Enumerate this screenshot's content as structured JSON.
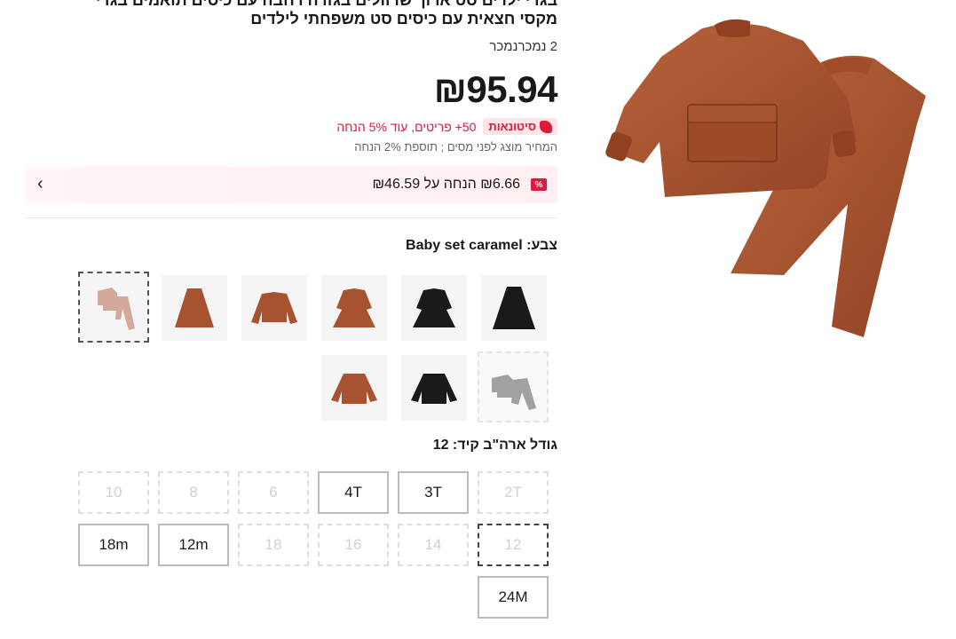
{
  "product": {
    "title_line1": "בגדי ילדים סט ארוך שרוולים בגזרה רחבה עם כיסים תואמים בגדי",
    "title_line2": "מקסי חצאית עם כיסים סט משפחתי לילדים",
    "sold": "2 נמכרנמכר",
    "price": "₪95.94",
    "bulk_tag": "סיטונאות",
    "bulk_text": "50+ פריטים, עוד 5% הנחה",
    "tax_note": "המחיר מוצג לפני מסים ; תוספת 2% הנחה",
    "coupon_badge": "%",
    "coupon_text": "₪6.66 הנחה על ₪46.59",
    "coupon_arrow": "›"
  },
  "color": {
    "label": "צבע: Baby set caramel",
    "options": [
      {
        "name": "Baby set caramel",
        "state": "selected",
        "icon": "pants-set-pink"
      },
      {
        "name": "caramel maxi skirt",
        "state": "normal",
        "icon": "skirt-brown"
      },
      {
        "name": "caramel jacket",
        "state": "normal",
        "icon": "jacket-brown"
      },
      {
        "name": "caramel dress",
        "state": "normal",
        "icon": "dress-brown"
      },
      {
        "name": "black dress",
        "state": "normal",
        "icon": "dress-black"
      },
      {
        "name": "black maxi skirt",
        "state": "normal",
        "icon": "skirt-black"
      },
      {
        "name": "caramel sweatshirt",
        "state": "normal",
        "icon": "sweatshirt-brown"
      },
      {
        "name": "black sweatshirt",
        "state": "normal",
        "icon": "sweatshirt-black"
      },
      {
        "name": "grey baby set",
        "state": "disabled",
        "icon": "pants-set-grey"
      }
    ]
  },
  "size": {
    "label": "גודל ארה\"ב קיד: 12",
    "options": [
      {
        "label": "2T",
        "state": "disabled"
      },
      {
        "label": "3T",
        "state": "normal"
      },
      {
        "label": "4T",
        "state": "normal"
      },
      {
        "label": "6",
        "state": "disabled"
      },
      {
        "label": "8",
        "state": "disabled"
      },
      {
        "label": "10",
        "state": "disabled"
      },
      {
        "label": "12",
        "state": "selected"
      },
      {
        "label": "14",
        "state": "disabled"
      },
      {
        "label": "16",
        "state": "disabled"
      },
      {
        "label": "18",
        "state": "disabled"
      },
      {
        "label": "12m",
        "state": "normal"
      },
      {
        "label": "18m",
        "state": "normal"
      },
      {
        "label": "24M",
        "state": "normal"
      }
    ]
  },
  "colors": {
    "accent": "#e0183b",
    "caramel": "#a8532f",
    "black": "#1a1a1a"
  }
}
